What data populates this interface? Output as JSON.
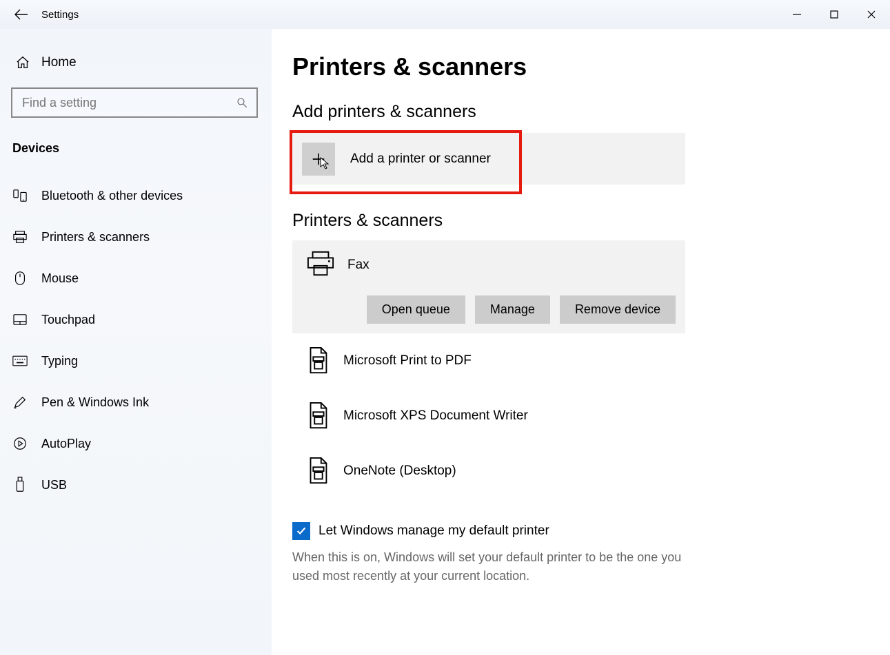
{
  "window": {
    "title": "Settings"
  },
  "sidebar": {
    "home_label": "Home",
    "search_placeholder": "Find a setting",
    "category": "Devices",
    "items": [
      {
        "label": "Bluetooth & other devices",
        "icon": "bluetooth"
      },
      {
        "label": "Printers & scanners",
        "icon": "printer"
      },
      {
        "label": "Mouse",
        "icon": "mouse"
      },
      {
        "label": "Touchpad",
        "icon": "touchpad"
      },
      {
        "label": "Typing",
        "icon": "keyboard"
      },
      {
        "label": "Pen & Windows Ink",
        "icon": "pen"
      },
      {
        "label": "AutoPlay",
        "icon": "autoplay"
      },
      {
        "label": "USB",
        "icon": "usb"
      }
    ]
  },
  "main": {
    "page_title": "Printers & scanners",
    "add_section_title": "Add printers & scanners",
    "add_button_label": "Add a printer or scanner",
    "list_title": "Printers & scanners",
    "selected_printer": {
      "name": "Fax",
      "actions": {
        "open_queue": "Open queue",
        "manage": "Manage",
        "remove": "Remove device"
      }
    },
    "printers": [
      {
        "name": "Microsoft Print to PDF"
      },
      {
        "name": "Microsoft XPS Document Writer"
      },
      {
        "name": "OneNote (Desktop)"
      }
    ],
    "default_checkbox": {
      "label": "Let Windows manage my default printer",
      "checked": true
    },
    "default_description": "When this is on, Windows will set your default printer to be the one you used most recently at your current location."
  }
}
